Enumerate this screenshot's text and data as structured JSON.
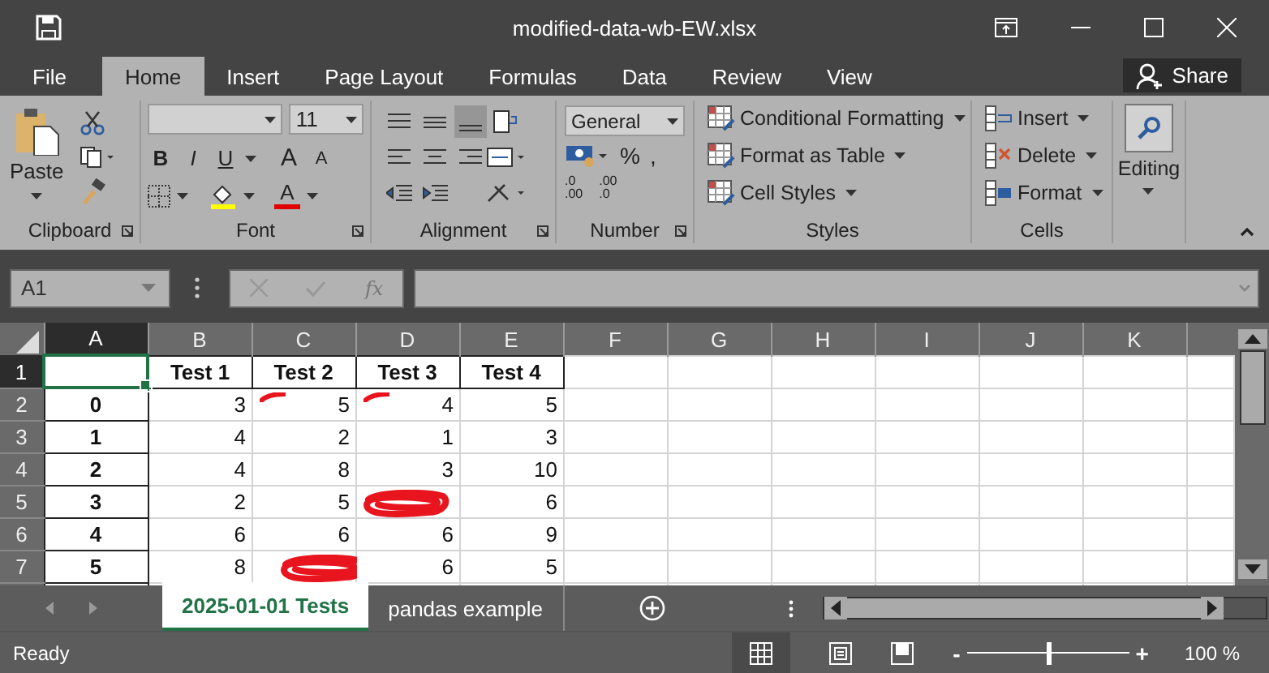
{
  "window": {
    "title": "modified-data-wb-EW.xlsx"
  },
  "tabs": [
    {
      "label": "File",
      "selected": false
    },
    {
      "label": "Home",
      "selected": true
    },
    {
      "label": "Insert",
      "selected": false
    },
    {
      "label": "Page Layout",
      "selected": false
    },
    {
      "label": "Formulas",
      "selected": false
    },
    {
      "label": "Data",
      "selected": false
    },
    {
      "label": "Review",
      "selected": false
    },
    {
      "label": "View",
      "selected": false
    }
  ],
  "share": "Share",
  "ribbon": {
    "clipboard": {
      "label": "Clipboard",
      "paste": "Paste"
    },
    "font": {
      "label": "Font",
      "size": "11",
      "bold": "B",
      "italic": "I",
      "underline": "U",
      "grow": "A",
      "shrink": "A",
      "font_color": "A"
    },
    "alignment": {
      "label": "Alignment"
    },
    "number": {
      "label": "Number",
      "format": "General",
      "percent": "%",
      "comma": ",",
      "increase_decimal": [
        ".0",
        ".00"
      ],
      "decrease_decimal": [
        ".00",
        ".0"
      ]
    },
    "styles": {
      "label": "Styles",
      "items": [
        "Conditional Formatting",
        "Format as Table",
        "Cell Styles"
      ]
    },
    "cells": {
      "label": "Cells",
      "items": [
        "Insert",
        "Delete",
        "Format"
      ]
    },
    "editing": {
      "label": "Editing"
    }
  },
  "formula_bar": {
    "name_box": "A1",
    "fx": "fx"
  },
  "sheet": {
    "columns": [
      {
        "label": "A",
        "selected": true
      },
      {
        "label": "B",
        "selected": false
      },
      {
        "label": "C",
        "selected": false
      },
      {
        "label": "D",
        "selected": false
      },
      {
        "label": "E",
        "selected": false
      },
      {
        "label": "F",
        "selected": false
      },
      {
        "label": "G",
        "selected": false
      },
      {
        "label": "H",
        "selected": false
      },
      {
        "label": "I",
        "selected": false
      },
      {
        "label": "J",
        "selected": false
      },
      {
        "label": "K",
        "selected": false
      }
    ],
    "header_row": {
      "number": "1",
      "selected": true,
      "cells": [
        "",
        "Test 1",
        "Test 2",
        "Test 3",
        "Test 4"
      ]
    },
    "rows": [
      {
        "number": "2",
        "selected": false,
        "cells": [
          {
            "text": "0",
            "marked": false,
            "covered": false
          },
          {
            "text": "3",
            "marked": false,
            "covered": false
          },
          {
            "text": "5",
            "marked": true,
            "covered": false
          },
          {
            "text": "4",
            "marked": true,
            "covered": false
          },
          {
            "text": "5",
            "marked": false,
            "covered": false
          }
        ]
      },
      {
        "number": "3",
        "selected": false,
        "cells": [
          {
            "text": "1",
            "marked": false,
            "covered": false
          },
          {
            "text": "4",
            "marked": false,
            "covered": false
          },
          {
            "text": "2",
            "marked": false,
            "covered": false
          },
          {
            "text": "1",
            "marked": false,
            "covered": false
          },
          {
            "text": "3",
            "marked": false,
            "covered": false
          }
        ]
      },
      {
        "number": "4",
        "selected": false,
        "cells": [
          {
            "text": "2",
            "marked": false,
            "covered": false
          },
          {
            "text": "4",
            "marked": false,
            "covered": false
          },
          {
            "text": "8",
            "marked": false,
            "covered": false
          },
          {
            "text": "3",
            "marked": false,
            "covered": false
          },
          {
            "text": "10",
            "marked": false,
            "covered": false
          }
        ]
      },
      {
        "number": "5",
        "selected": false,
        "cells": [
          {
            "text": "3",
            "marked": false,
            "covered": false
          },
          {
            "text": "2",
            "marked": false,
            "covered": false
          },
          {
            "text": "5",
            "marked": false,
            "covered": false
          },
          {
            "marked": false,
            "covered": true
          },
          {
            "text": "6",
            "marked": false,
            "covered": false
          }
        ]
      },
      {
        "number": "6",
        "selected": false,
        "cells": [
          {
            "text": "4",
            "marked": false,
            "covered": false
          },
          {
            "text": "6",
            "marked": false,
            "covered": false
          },
          {
            "text": "6",
            "marked": false,
            "covered": false
          },
          {
            "text": "6",
            "marked": false,
            "covered": false
          },
          {
            "text": "9",
            "marked": false,
            "covered": false
          }
        ]
      },
      {
        "number": "7",
        "selected": false,
        "cells": [
          {
            "text": "5",
            "marked": false,
            "covered": false
          },
          {
            "text": "8",
            "marked": false,
            "covered": false
          },
          {
            "marked": false,
            "covered": true
          },
          {
            "text": "6",
            "marked": false,
            "covered": false
          },
          {
            "text": "5",
            "marked": false,
            "covered": false
          }
        ]
      }
    ]
  },
  "sheet_tabs": [
    {
      "label": "2025-01-01 Tests",
      "selected": true
    },
    {
      "label": "pandas example",
      "selected": false
    }
  ],
  "status_bar": {
    "status": "Ready",
    "zoom_out": "-",
    "zoom_in": "+",
    "zoom": "100 %",
    "zoom_slider": {
      "level": 0.5
    }
  }
}
